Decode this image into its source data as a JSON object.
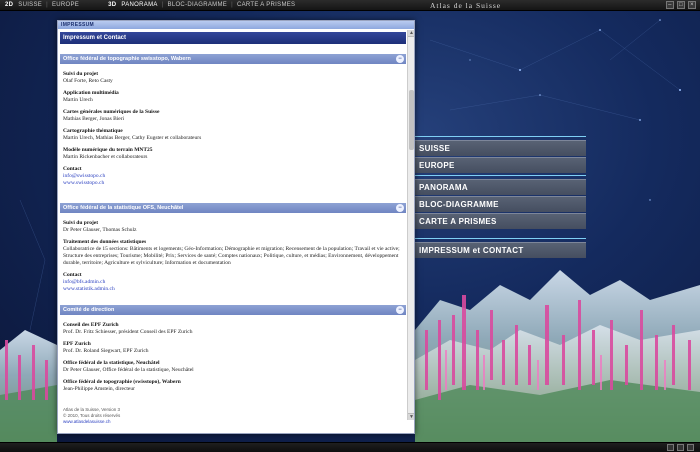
{
  "topbar": {
    "mode_2d": "2D",
    "nav_suisse": "SUISSE",
    "nav_europe": "EUROPE",
    "mode_3d": "3D",
    "nav_panorama": "PANORAMA",
    "nav_bloc": "BLOC-DIAGRAMME",
    "nav_carte": "CARTE A PRISMES",
    "brand": "Atlas de la Suisse"
  },
  "menu": {
    "items": [
      "SUISSE",
      "EUROPE",
      "PANORAMA",
      "BLOC-DIAGRAMME",
      "CARTE A PRISMES"
    ],
    "impressum": "IMPRESSUM et CONTACT"
  },
  "modal": {
    "title": "IMPRESSUM",
    "header": "Impressum et Contact",
    "sections": [
      {
        "title": "Office fédéral de topographie swisstopo, Wabern",
        "entries": [
          {
            "label": "Suivi du projet",
            "value": "Olaf Forte, Reto Casty"
          },
          {
            "label": "Application multimédia",
            "value": "Martin Urech"
          },
          {
            "label": "Cartes générales numériques de la Suisse",
            "value": "Mathias Berger, Jonas Bieri"
          },
          {
            "label": "Cartographie thématique",
            "value": "Martin Urech, Mathias Berger, Cathy Eugster et collaborateurs"
          },
          {
            "label": "Modèle numérique du terrain MNT25",
            "value": "Martin Rickenbacher et collaborateurs"
          },
          {
            "label": "Contact",
            "links": [
              "info@swisstopo.ch",
              "www.swisstopo.ch"
            ]
          }
        ]
      },
      {
        "title": "Office fédéral de la statistique OFS, Neuchâtel",
        "entries": [
          {
            "label": "Suivi du projet",
            "value": "Dr Peter Glauser, Thomas Schulz"
          },
          {
            "label": "Traitement des données statistiques",
            "value": "Collaboratrice de 15 sections: Bâtiments et logements; Géo-Information; Démographie et migration; Recensement de la population; Travail et vie active; Structure des entreprises; Tourisme; Mobilité; Prix; Services de santé; Comptes nationaux; Politique, culture, et médias; Environnement, développement durable, territoire; Agriculture et sylviculture; Information et documentation"
          },
          {
            "label": "Contact",
            "links": [
              "info@bfs.admin.ch",
              "www.statistik.admin.ch"
            ]
          }
        ]
      },
      {
        "title": "Comité de direction",
        "entries": [
          {
            "label": "Conseil des EPF Zurich",
            "value": "Prof. Dr. Fritz Schiesser, président Conseil des EPF Zurich"
          },
          {
            "label": "EPF Zurich",
            "value": "Prof. Dr. Roland Siegwart, EPF Zurich"
          },
          {
            "label": "Office fédéral de la statistique, Neuchâtel",
            "value": "Dr Peter Glauser, Office fédéral de la statistique, Neuchâtel"
          },
          {
            "label": "Office fédéral de topographie (swisstopo), Wabern",
            "value": "Jean-Philippe Amstein, directeur"
          }
        ]
      }
    ],
    "footer": {
      "line1": "Atlas de la Suisse, Version 3",
      "line2": "© 2010, Tous droits réservés",
      "link": "www.atlasdelasuisse.ch"
    }
  }
}
